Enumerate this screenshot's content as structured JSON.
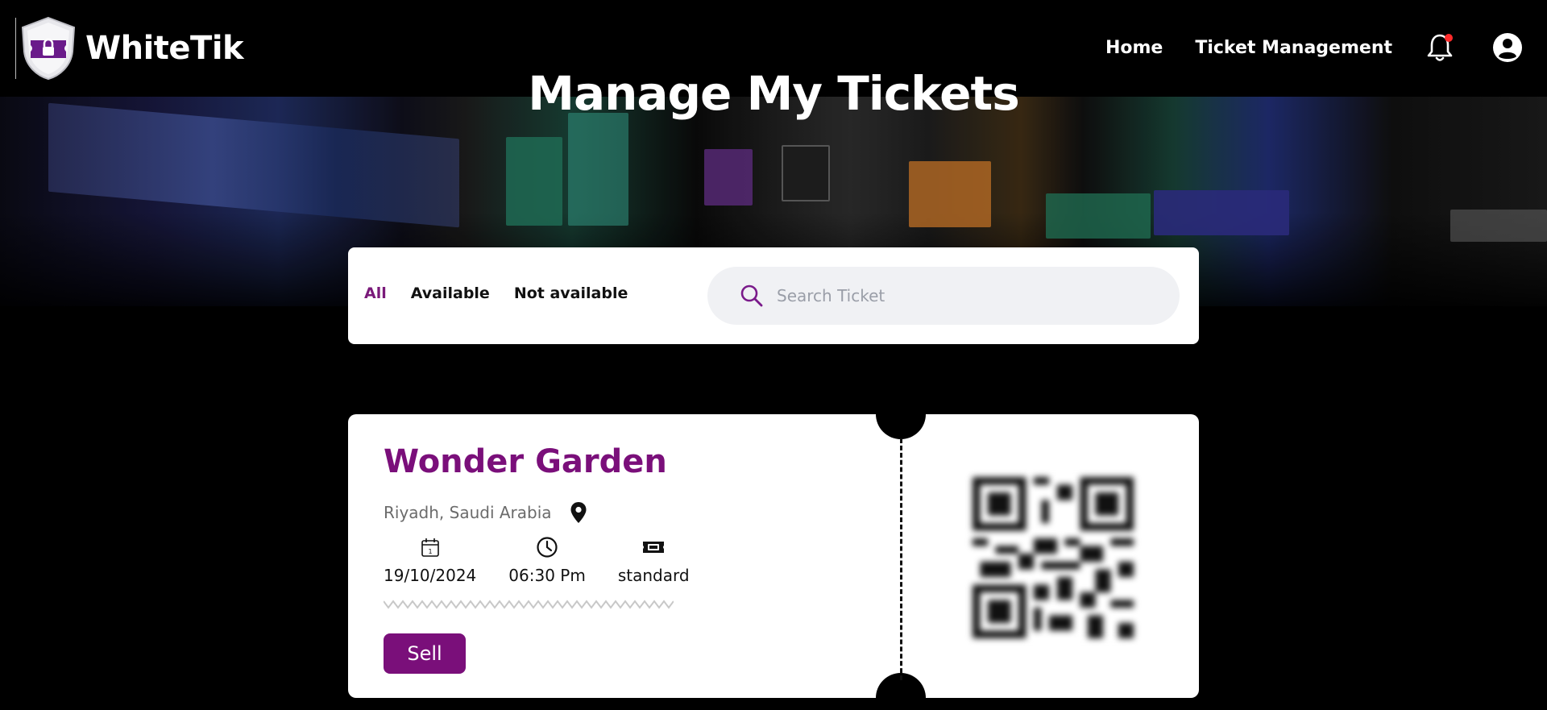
{
  "header": {
    "brand": "WhiteTik",
    "nav": {
      "home": "Home",
      "ticket_management": "Ticket Management"
    },
    "has_notification": true
  },
  "page": {
    "title": "Manage My Tickets"
  },
  "filters": {
    "tabs": [
      {
        "label": "All",
        "active": true
      },
      {
        "label": "Available",
        "active": false
      },
      {
        "label": "Not available",
        "active": false
      }
    ],
    "search_placeholder": "Search Ticket",
    "search_value": ""
  },
  "ticket": {
    "title": "Wonder Garden",
    "location": "Riyadh, Saudi Arabia",
    "date": "19/10/2024",
    "time": "06:30 Pm",
    "type": "standard",
    "sell_label": "Sell"
  },
  "colors": {
    "accent": "#7a0f7a",
    "notification_dot": "#ff2a2a",
    "background": "#000000",
    "card": "#ffffff"
  },
  "icons": {
    "logo": "shield-lock-icon",
    "notification": "bell-icon",
    "user": "user-circle-icon",
    "search": "search-icon",
    "location": "location-pin-icon",
    "date": "calendar-icon",
    "time": "clock-icon",
    "ticket_type": "ticket-icon",
    "qr": "qr-code-icon"
  }
}
